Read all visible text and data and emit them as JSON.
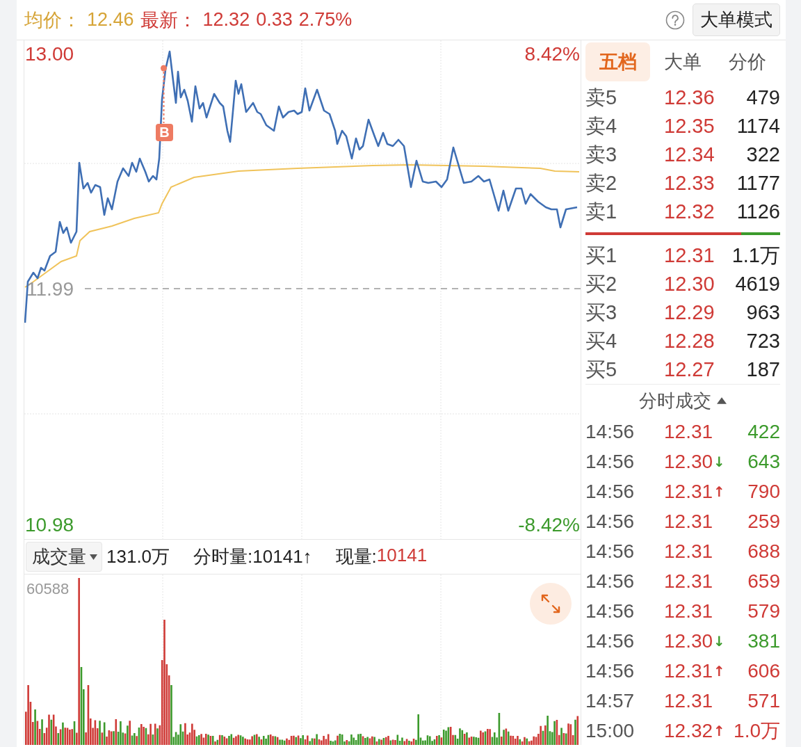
{
  "header": {
    "avg_label": "均价：",
    "avg_value": "12.46",
    "latest_label": "最新：",
    "latest_value": "12.32",
    "change": "0.33",
    "change_pct": "2.75%",
    "mode_button": "大单模式"
  },
  "price_chart": {
    "top_price": "13.00",
    "top_pct": "8.42%",
    "ref_price": "11.99",
    "bottom_price": "10.98",
    "bottom_pct": "-8.42%",
    "trade_marker": "B"
  },
  "volume_header": {
    "selector": "成交量",
    "total": "131.0万",
    "interval": "分时量:10141↑",
    "current_label": "现量:",
    "current_value": "10141"
  },
  "volume_chart": {
    "max_label": "60588"
  },
  "tabs": [
    {
      "label": "五档",
      "selected": true
    },
    {
      "label": "大单",
      "selected": false
    },
    {
      "label": "分价",
      "selected": false
    }
  ],
  "asks": [
    {
      "label": "卖5",
      "price": "12.36",
      "volume": "479"
    },
    {
      "label": "卖4",
      "price": "12.35",
      "volume": "1174"
    },
    {
      "label": "卖3",
      "price": "12.34",
      "volume": "322"
    },
    {
      "label": "卖2",
      "price": "12.33",
      "volume": "1177"
    },
    {
      "label": "卖1",
      "price": "12.32",
      "volume": "1126"
    }
  ],
  "ratio_bar": {
    "level": 0.8
  },
  "bids": [
    {
      "label": "买1",
      "price": "12.31",
      "volume": "1.1万"
    },
    {
      "label": "买2",
      "price": "12.30",
      "volume": "4619"
    },
    {
      "label": "买3",
      "price": "12.29",
      "volume": "963"
    },
    {
      "label": "买4",
      "price": "12.28",
      "volume": "723"
    },
    {
      "label": "买5",
      "price": "12.27",
      "volume": "187"
    }
  ],
  "trades_title": "分时成交",
  "trades": [
    {
      "time": "14:56",
      "price": "12.31",
      "volume": "422",
      "color": "#3c9a2c"
    },
    {
      "time": "14:56",
      "price": "12.30",
      "tick": "↓",
      "volume": "643",
      "color": "#3c9a2c"
    },
    {
      "time": "14:56",
      "price": "12.31",
      "tick": "↑",
      "volume": "790",
      "color": "#cf3a36"
    },
    {
      "time": "14:56",
      "price": "12.31",
      "volume": "259",
      "color": "#cf3a36"
    },
    {
      "time": "14:56",
      "price": "12.31",
      "volume": "688",
      "color": "#cf3a36"
    },
    {
      "time": "14:56",
      "price": "12.31",
      "volume": "659",
      "color": "#cf3a36"
    },
    {
      "time": "14:56",
      "price": "12.31",
      "volume": "579",
      "color": "#cf3a36"
    },
    {
      "time": "14:56",
      "price": "12.30",
      "tick": "↓",
      "volume": "381",
      "color": "#3c9a2c"
    },
    {
      "time": "14:56",
      "price": "12.31",
      "tick": "↑",
      "volume": "606",
      "color": "#cf3a36"
    },
    {
      "time": "14:57",
      "price": "12.31",
      "volume": "571",
      "color": "#cf3a36"
    },
    {
      "time": "15:00",
      "price": "12.32",
      "tick": "↑",
      "volume": "1.0万",
      "color": "#cf3a36"
    }
  ]
}
